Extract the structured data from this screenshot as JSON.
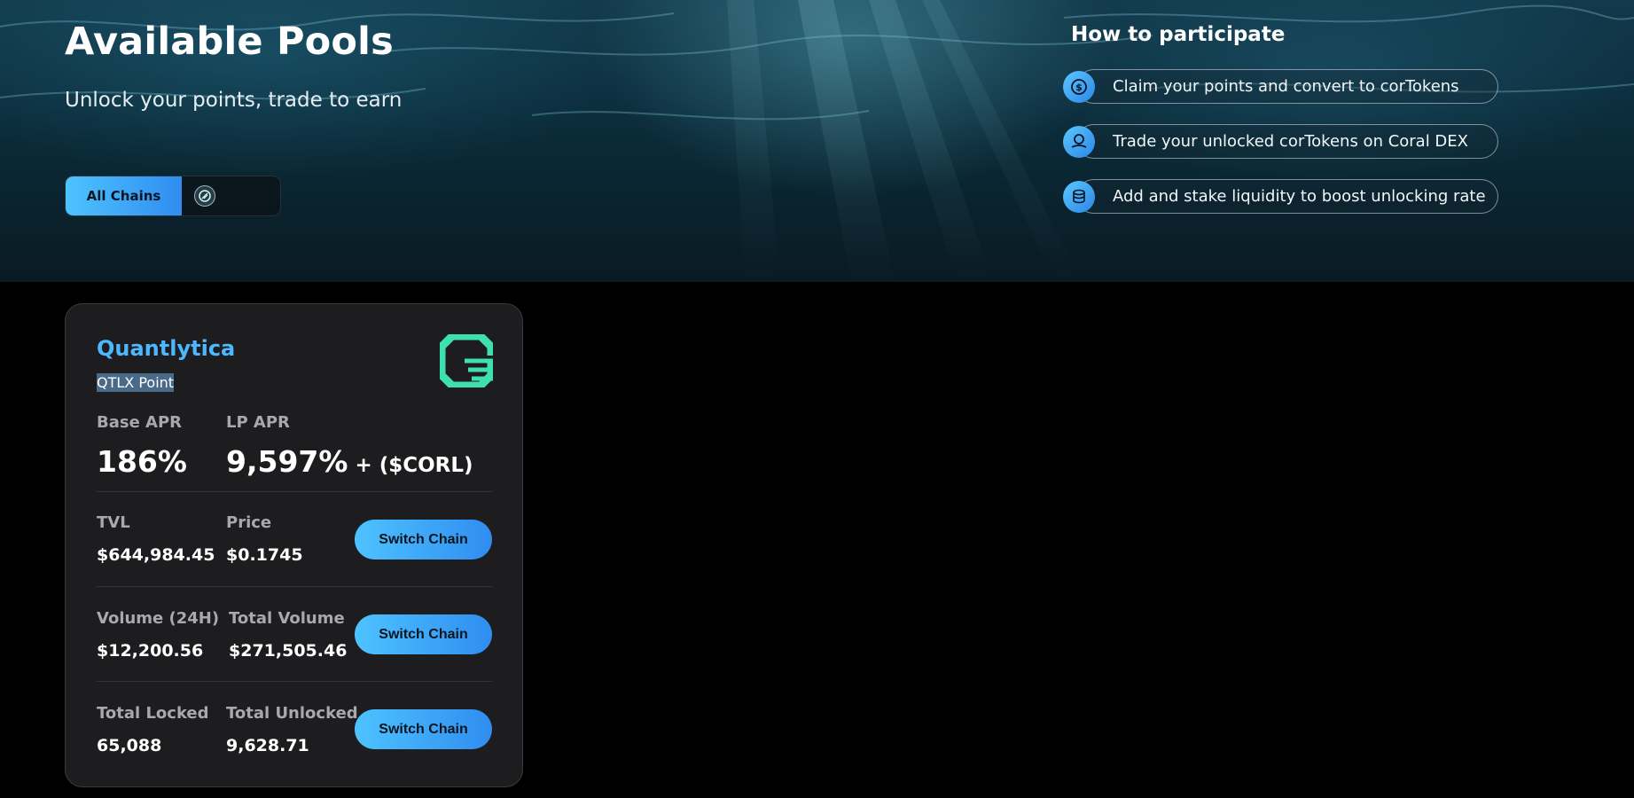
{
  "hero": {
    "title": "Available Pools",
    "subtitle": "Unlock your points, trade to earn",
    "chain_filter": {
      "all_label": "All Chains",
      "chain_icon": "chain-logo-icon"
    }
  },
  "how": {
    "title": "How to participate",
    "steps": [
      {
        "label": "Claim your points and convert to corTokens",
        "icon": "convert-coin-icon"
      },
      {
        "label": "Trade your unlocked corTokens on Coral DEX",
        "icon": "trade-coin-icon"
      },
      {
        "label": "Add and stake liquidity to boost unlocking rate",
        "icon": "stacked-coins-icon"
      }
    ]
  },
  "pool": {
    "name": "Quantlytica",
    "point": "QTLX Point",
    "logo": "quantlytica-logo-icon",
    "base_apr_label": "Base APR",
    "base_apr": "186%",
    "lp_apr_label": "LP APR",
    "lp_apr": "9,597%",
    "lp_apr_suffix": " + ($CORL)",
    "rows": [
      {
        "left_label": "TVL",
        "left_value": "$644,984.45",
        "right_label": "Price",
        "right_value": "$0.1745",
        "button": "Switch Chain"
      },
      {
        "left_label": "Volume (24H)",
        "left_value": "$12,200.56",
        "right_label": "Total Volume",
        "right_value": "$271,505.46",
        "button": "Switch Chain"
      },
      {
        "left_label": "Total Locked",
        "left_value": "65,088",
        "right_label": "Total Unlocked",
        "right_value": "9,628.71",
        "button": "Switch Chain"
      }
    ]
  },
  "colors": {
    "accent": "#4db8ff",
    "button_gradient_start": "#4ec3ff",
    "button_gradient_end": "#2f8df0",
    "card_bg": "#1d1d1f",
    "logo_green": "#3fe0b0"
  }
}
